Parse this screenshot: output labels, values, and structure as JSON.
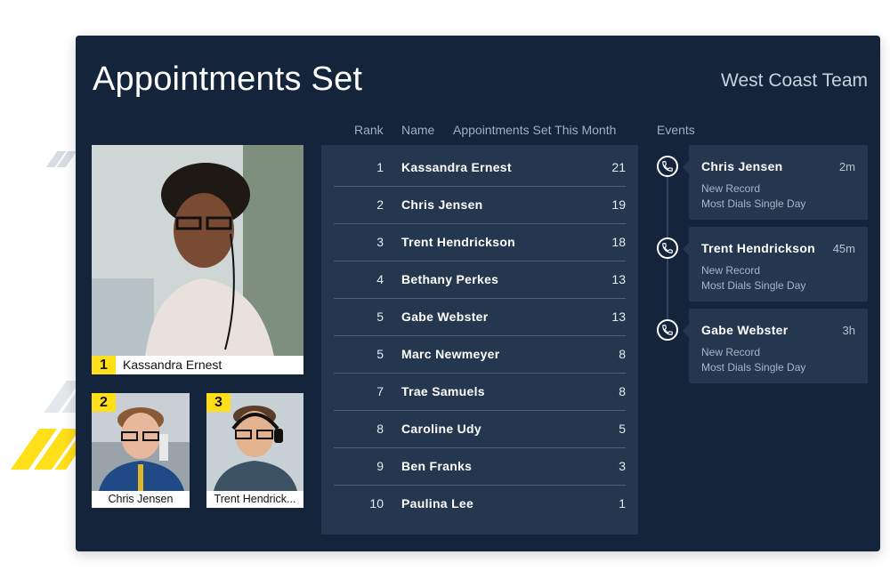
{
  "header": {
    "title": "Appointments Set",
    "team": "West Coast Team"
  },
  "columns": {
    "rank": "Rank",
    "name": "Name",
    "metric": "Appointments Set This Month",
    "events": "Events"
  },
  "leaders": {
    "first": {
      "rank": "1",
      "name": "Kassandra Ernest"
    },
    "second": {
      "rank": "2",
      "name": "Chris Jensen"
    },
    "third": {
      "rank": "3",
      "name": "Trent Hendrick..."
    }
  },
  "rows": [
    {
      "rank": "1",
      "name": "Kassandra Ernest",
      "value": "21"
    },
    {
      "rank": "2",
      "name": "Chris Jensen",
      "value": "19"
    },
    {
      "rank": "3",
      "name": "Trent Hendrickson",
      "value": "18"
    },
    {
      "rank": "4",
      "name": "Bethany Perkes",
      "value": "13"
    },
    {
      "rank": "5",
      "name": "Gabe Webster",
      "value": "13"
    },
    {
      "rank": "5",
      "name": "Marc Newmeyer",
      "value": "8"
    },
    {
      "rank": "7",
      "name": "Trae Samuels",
      "value": "8"
    },
    {
      "rank": "8",
      "name": "Caroline Udy",
      "value": "5"
    },
    {
      "rank": "9",
      "name": "Ben Franks",
      "value": "3"
    },
    {
      "rank": "10",
      "name": "Paulina Lee",
      "value": "1"
    }
  ],
  "events": [
    {
      "name": "Chris Jensen",
      "time": "2m",
      "line1": "New Record",
      "line2": "Most Dials Single Day",
      "icon": "phone-icon"
    },
    {
      "name": "Trent Hendrickson",
      "time": "45m",
      "line1": "New Record",
      "line2": "Most Dials Single Day",
      "icon": "phone-icon"
    },
    {
      "name": "Gabe Webster",
      "time": "3h",
      "line1": "New Record",
      "line2": "Most Dials Single Day",
      "icon": "phone-icon"
    }
  ],
  "colors": {
    "panel": "#13243b",
    "card": "#24374e",
    "badge": "#ffde1a"
  }
}
